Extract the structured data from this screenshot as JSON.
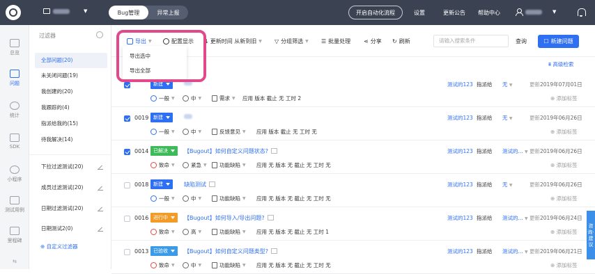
{
  "topbar": {
    "tabs": [
      {
        "label": "Bug管理",
        "active": true
      },
      {
        "label": "异常上报",
        "active": false
      }
    ],
    "auto_btn": "开启自动化流程",
    "nav": [
      "设置",
      "更新公告",
      "帮助中心"
    ]
  },
  "leftnav": [
    {
      "label": "总览",
      "icon": "home-icon"
    },
    {
      "label": "问题",
      "icon": "issue-icon",
      "active": true
    },
    {
      "label": "统计",
      "icon": "chart-icon"
    },
    {
      "label": "SDK",
      "icon": "sdk-icon"
    },
    {
      "label": "小程序",
      "icon": "miniprogram-icon"
    },
    {
      "label": "测试用例",
      "icon": "testcase-icon"
    },
    {
      "label": "里程碑",
      "icon": "milestone-icon"
    }
  ],
  "filters": {
    "header": "过滤器",
    "items": [
      "全部问题(20)",
      "未关闭问题(19)",
      "我创建的(20)",
      "我跟踪的(4)",
      "指派给我的(15)",
      "待我解决(14)"
    ],
    "custom": [
      "下拉过滤测试(20)",
      "成员过滤测试(20)",
      "日期过滤测试(20)",
      "日期测试2(0)"
    ],
    "add_label": "自定义过滤器"
  },
  "toolbar": {
    "export": "导出",
    "config": "配置显示",
    "sort": "更新时间 从新到旧",
    "group": "分组筛选",
    "batch": "批量处理",
    "share": "分享",
    "refresh": "刷新",
    "search_placeholder": "请输入搜索条件",
    "query": "查询",
    "new_issue": "新建问题",
    "advanced": "高级检索"
  },
  "export_menu": [
    "导出选中",
    "导出全部"
  ],
  "common": {
    "assign_label": "指派给",
    "update_label": "更新",
    "add_tag": "添加标签",
    "app": "应用",
    "version": "版本",
    "deadline": "截止",
    "hours": "工时"
  },
  "rows": [
    {
      "id": "",
      "checked": true,
      "status": "新建",
      "status_color": "#2f6ff2",
      "title": "",
      "assignee": "测试的123",
      "assign_to": "无",
      "date": "2019年07月01日",
      "severity": "一般",
      "sev_color": "#2f6ff2",
      "priority": "中",
      "type": "需求",
      "meta": "应用   版本   截止 无   工时 2"
    },
    {
      "id": "0019",
      "checked": true,
      "status": "新建",
      "status_color": "#2f6ff2",
      "title": "",
      "assignee": "测试的123",
      "assign_to": "无",
      "date": "2019年06月26日",
      "severity": "一般",
      "sev_color": "#2f6ff2",
      "priority": "中",
      "type": "反馈意见",
      "meta": "应用   版本   截止 无   工时 无"
    },
    {
      "id": "0014",
      "checked": true,
      "status": "已解决",
      "status_color": "#3dbb5a",
      "title": "【Bugout】如何自定义问题状态?",
      "assignee": "测试的123",
      "assign_to": "测试的...",
      "date": "2019年06月26日",
      "severity": "致命",
      "sev_color": "#e5483a",
      "priority": "紧急",
      "type": "功能缺陷",
      "meta": "应用 无   版本 无   截止 无   工时 无"
    },
    {
      "id": "0018",
      "checked": false,
      "status": "新建",
      "status_color": "#2f6ff2",
      "title": "缺陷测试",
      "assignee": "测试的123",
      "assign_to": "无",
      "date": "2019年06月26日",
      "severity": "一般",
      "sev_color": "#2f6ff2",
      "priority": "中",
      "type": "功能缺陷",
      "meta": "应用 无   版本 无   截止 无   工时 无"
    },
    {
      "id": "0016",
      "checked": false,
      "status": "进行中",
      "status_color": "#f29b26",
      "title": "【Bugout】如何导入/导出问题?",
      "assignee": "测试的123",
      "assign_to": "测试的...",
      "date": "2019年06月24日",
      "severity": "致命",
      "sev_color": "#e5483a",
      "priority": "高",
      "type": "功能缺陷",
      "meta": "应用 无   版本 无   截止 无   工时 1"
    },
    {
      "id": "0013",
      "checked": false,
      "status": "已验收",
      "status_color": "#3c9be8",
      "title": "【Bugout】如何自定义问题类型?",
      "assignee": "测试的123",
      "assign_to": "测试的...",
      "date": "2019年06月21日",
      "severity": "致命",
      "sev_color": "#e5483a",
      "priority": "中",
      "type": "功能缺陷",
      "meta": "应用 无   版本 无   截止 无   工时 无"
    }
  ],
  "float_tab": "咨询·建议"
}
